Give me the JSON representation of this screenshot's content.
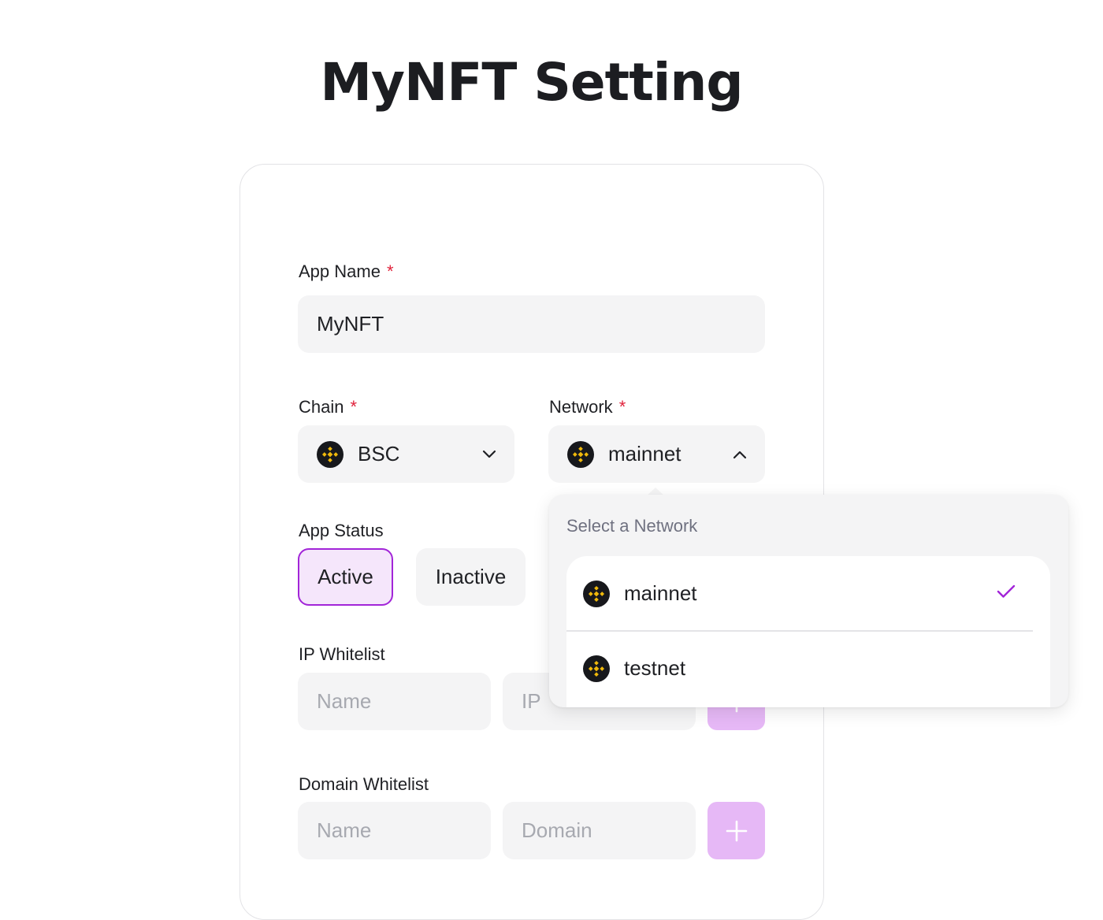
{
  "page": {
    "title": "MyNFT Setting"
  },
  "form": {
    "app_name": {
      "label": "App Name",
      "required_mark": "*",
      "value": "MyNFT"
    },
    "chain": {
      "label": "Chain",
      "required_mark": "*",
      "value": "BSC",
      "icon": "bnb-chain-icon"
    },
    "network": {
      "label": "Network",
      "required_mark": "*",
      "value": "mainnet",
      "icon": "bnb-chain-icon",
      "expanded": true
    },
    "app_status": {
      "label": "App Status",
      "options": [
        "Active",
        "Inactive"
      ],
      "selected": "Active"
    },
    "ip_whitelist": {
      "label": "IP Whitelist",
      "name_placeholder": "Name",
      "ip_placeholder": "IP",
      "add_icon": "plus-icon"
    },
    "domain_whitelist": {
      "label": "Domain Whitelist",
      "name_placeholder": "Name",
      "domain_placeholder": "Domain",
      "add_icon": "plus-icon"
    }
  },
  "network_dropdown": {
    "title": "Select a Network",
    "options": [
      {
        "label": "mainnet",
        "selected": true
      },
      {
        "label": "testnet",
        "selected": false
      }
    ]
  },
  "colors": {
    "accent": "#a225d8",
    "active_bg": "#f5e6fb",
    "add_button": "#e6b8f6",
    "required": "#e0223b",
    "field_bg": "#f4f4f5",
    "bnb_yellow": "#f0b90b"
  }
}
